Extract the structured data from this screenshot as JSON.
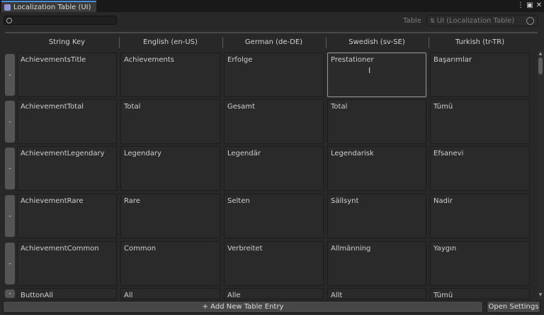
{
  "window": {
    "title": "Localization Table (UI)"
  },
  "toolbar": {
    "search_value": "",
    "table_label": "Table",
    "table_value": "UI (Localization Table)"
  },
  "table": {
    "columns": [
      "String Key",
      "English (en-US)",
      "German (de-DE)",
      "Swedish (sv-SE)",
      "Turkish (tr-TR)"
    ],
    "remove_label": "-",
    "rows": [
      [
        "AchievementsTitle",
        "Achievements",
        "Erfolge",
        "Prestationer",
        "Başarımlar"
      ],
      [
        "AchievementTotal",
        "Total",
        "Gesamt",
        "Total",
        "Tümü"
      ],
      [
        "AchievementLegendary",
        "Legendary",
        "Legendär",
        "Legendarisk",
        "Efsanevi"
      ],
      [
        "AchievementRare",
        "Rare",
        "Selten",
        "Sällsynt",
        "Nadir"
      ],
      [
        "AchievementCommon",
        "Common",
        "Verbreitet",
        "Allmänning",
        "Yaygın"
      ],
      [
        "ButtonAll",
        "All",
        "Alle",
        "Allt",
        "Tümü"
      ]
    ]
  },
  "footer": {
    "add_label": "+ Add New Table Entry",
    "open_settings_label": "Open Settings"
  },
  "colors": {
    "accent": "#4a8fd9",
    "background": "#282828",
    "cell": "#2a2a2a"
  }
}
